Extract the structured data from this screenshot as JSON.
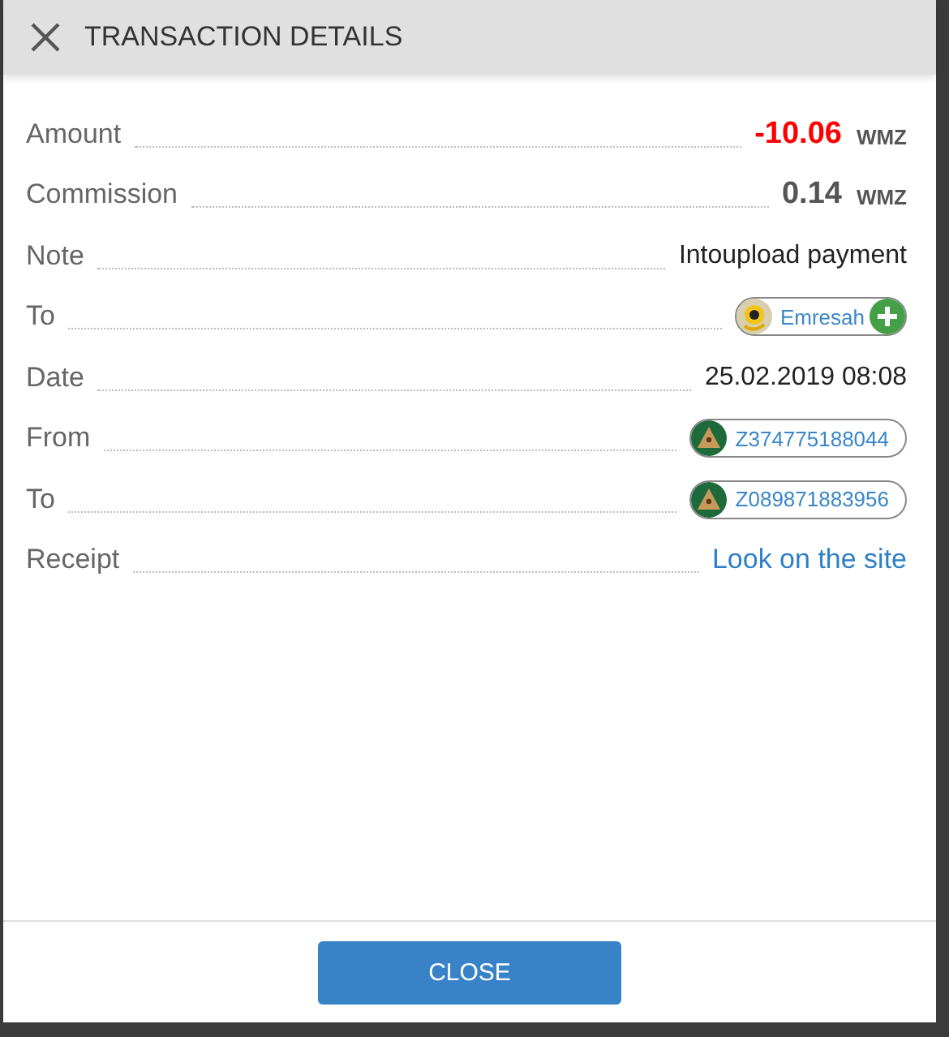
{
  "dialog": {
    "title": "TRANSACTION DETAILS"
  },
  "rows": [
    {
      "label": "Amount",
      "kind": "amount",
      "value": "-10.06",
      "currency": "WMZ",
      "negative": true
    },
    {
      "label": "Commission",
      "kind": "amount",
      "value": "0.14",
      "currency": "WMZ",
      "negative": false
    },
    {
      "label": "Note",
      "kind": "text",
      "value": "Intoupload payment"
    },
    {
      "label": "To",
      "kind": "user_chip",
      "value": "Emresah",
      "addable": true
    },
    {
      "label": "Date",
      "kind": "text",
      "value": "25.02.2019 08:08"
    },
    {
      "label": "From",
      "kind": "wallet_chip",
      "value": "Z374775188044",
      "addable": false
    },
    {
      "label": "To",
      "kind": "wallet_chip",
      "value": "Z089871883956",
      "addable": false
    },
    {
      "label": "Receipt",
      "kind": "link",
      "value": "Look on the site"
    }
  ],
  "footer": {
    "button": "CLOSE"
  }
}
